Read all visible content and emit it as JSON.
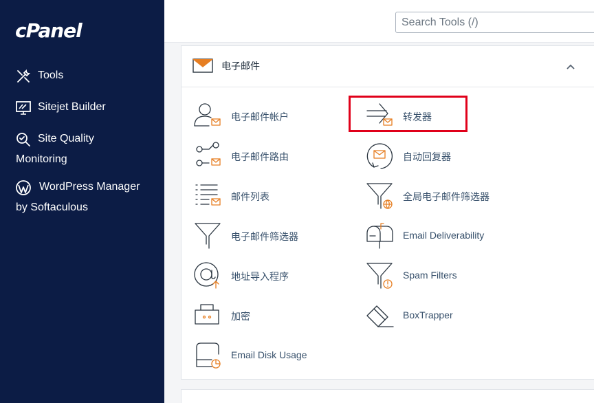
{
  "sidebar": {
    "logo": "cPanel",
    "items": [
      {
        "label": "Tools",
        "label2": ""
      },
      {
        "label": "Sitejet Builder",
        "label2": ""
      },
      {
        "label": "Site Quality",
        "label2": "Monitoring"
      },
      {
        "label": "WordPress Manager",
        "label2": "by Softaculous"
      }
    ]
  },
  "header": {
    "search_placeholder": "Search Tools (/)"
  },
  "panel": {
    "title": "电子邮件",
    "tools_left": [
      {
        "label": "电子邮件帐户"
      },
      {
        "label": "电子邮件路由"
      },
      {
        "label": "邮件列表"
      },
      {
        "label": "电子邮件筛选器"
      },
      {
        "label": "地址导入程序"
      },
      {
        "label": "加密"
      },
      {
        "label": "Email Disk Usage"
      }
    ],
    "tools_right": [
      {
        "label": "转发器"
      },
      {
        "label": "自动回复器"
      },
      {
        "label": "全局电子邮件筛选器"
      },
      {
        "label": "Email Deliverability"
      },
      {
        "label": "Spam Filters"
      },
      {
        "label": "BoxTrapper"
      }
    ]
  },
  "colors": {
    "sidebar_bg": "#0c1c45",
    "accent": "#e67e22",
    "highlight": "#e0001a"
  }
}
